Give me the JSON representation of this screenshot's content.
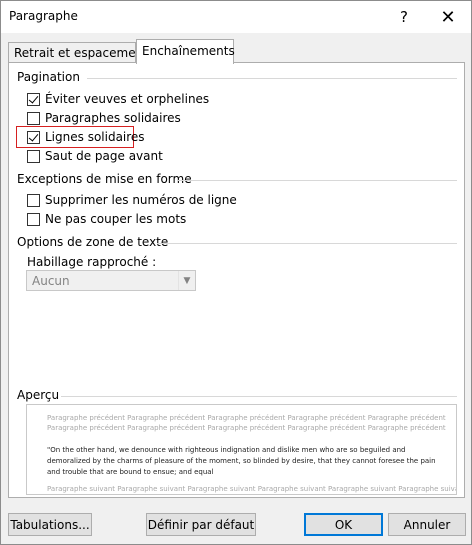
{
  "window": {
    "title": "Paragraphe",
    "help_label": "?",
    "close_label": "✕"
  },
  "tabs": [
    {
      "label": "Retrait et espacement"
    },
    {
      "label": "Enchaînements"
    }
  ],
  "sections": {
    "pagination": {
      "title": "Pagination",
      "items": [
        {
          "label": "Éviter veuves et orphelines",
          "checked": true
        },
        {
          "label": "Paragraphes solidaires",
          "checked": false
        },
        {
          "label": "Lignes solidaires",
          "checked": true
        },
        {
          "label": "Saut de page avant",
          "checked": false
        }
      ]
    },
    "exceptions": {
      "title": "Exceptions de mise en forme",
      "items": [
        {
          "label": "Supprimer les numéros de ligne",
          "checked": false
        },
        {
          "label": "Ne pas couper les mots",
          "checked": false
        }
      ]
    },
    "textbox": {
      "title": "Options de zone de texte",
      "field_label": "Habillage rapproché :",
      "selected": "Aucun"
    },
    "preview": {
      "title": "Aperçu",
      "prev_line_1": "Paragraphe précédent Paragraphe précédent Paragraphe précédent Paragraphe précédent Paragraphe précédent",
      "prev_line_2": "Paragraphe précédent Paragraphe précédent Paragraphe précédent Paragraphe précédent Paragraphe précédent",
      "main_text": "\"On the other hand, we denounce with righteous indignation and dislike men who are so beguiled and demoralized by the charms of pleasure of the moment, so blinded by desire, that they cannot foresee the pain and trouble that are bound to ensue; and equal",
      "next_line": "Paragraphe suivant Paragraphe suivant Paragraphe suivant Paragraphe suivant Paragraphe suivant Paragraphe suivant"
    }
  },
  "buttons": {
    "tabulations": "Tabulations...",
    "set_default": "Définir par défaut",
    "ok": "OK",
    "cancel": "Annuler"
  },
  "colors": {
    "highlight": "#d62020",
    "default_button_border": "#0078d7"
  }
}
